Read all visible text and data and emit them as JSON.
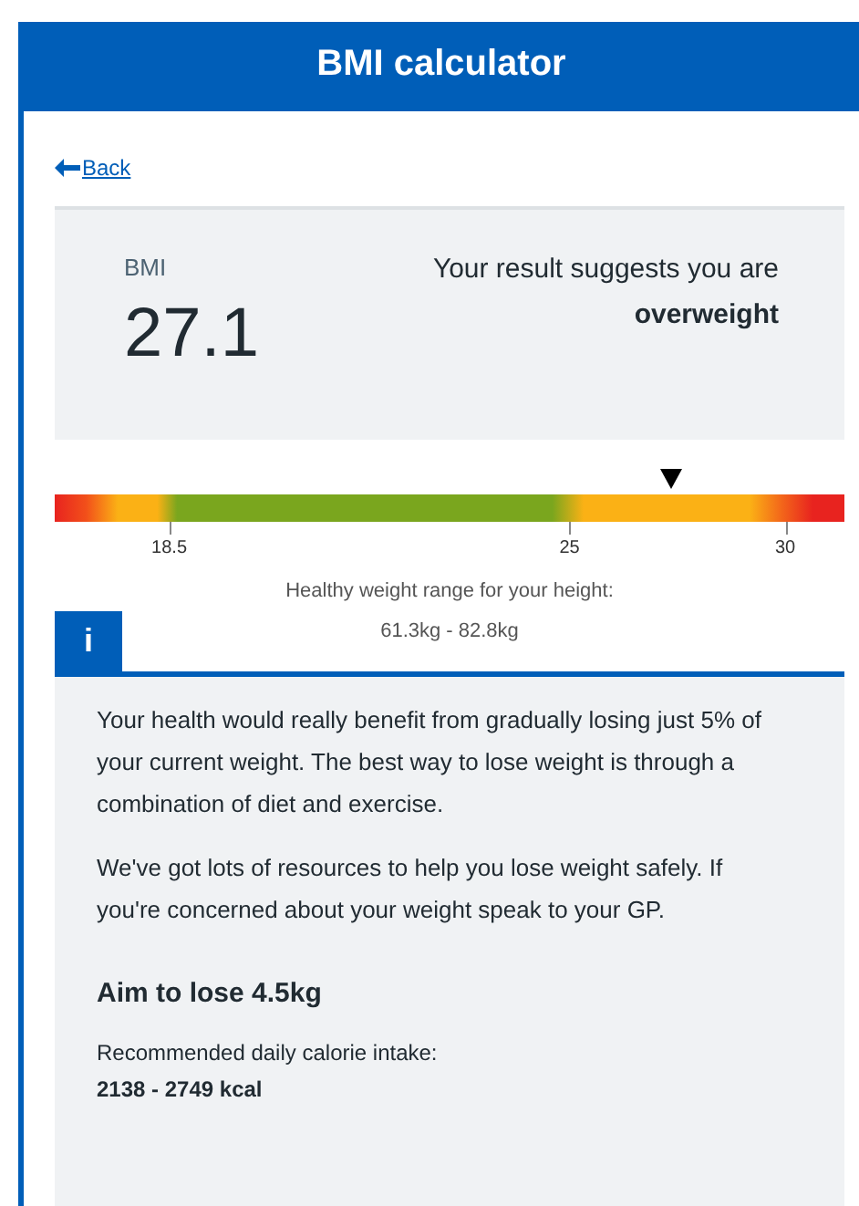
{
  "header": {
    "title": "BMI calculator"
  },
  "back_link": {
    "label": "Back"
  },
  "result": {
    "label": "BMI",
    "value": "27.1",
    "suggestion": "Your result suggests you are",
    "category": "overweight"
  },
  "scale": {
    "level": 0.78,
    "ticks": [
      "18.5",
      "25",
      "30"
    ],
    "range_label": "Healthy weight range for your height:",
    "range_value": "61.3kg - 82.8kg"
  },
  "info": {
    "icon": "i",
    "paragraphs": [
      "Your health would really benefit from gradually losing just 5% of your current weight. The best way to lose weight is through a combination of diet and exercise.",
      "We've got lots of resources to help you lose weight safely. If you're concerned about your weight speak to your GP."
    ],
    "goal": "Aim to lose 4.5kg",
    "calorie_label": "Recommended daily calorie intake:",
    "calorie_value": "2138 - 2749 kcal"
  }
}
